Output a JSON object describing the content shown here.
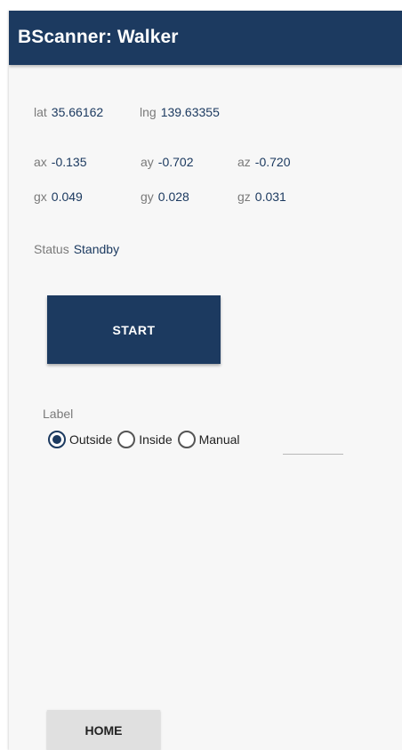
{
  "appbar": {
    "title": "BScanner: Walker"
  },
  "location": {
    "lat_label": "lat",
    "lat_value": "35.66162",
    "lng_label": "lng",
    "lng_value": "139.63355"
  },
  "accelerometer": {
    "ax_label": "ax",
    "ax_value": "-0.135",
    "ay_label": "ay",
    "ay_value": "-0.702",
    "az_label": "az",
    "az_value": "-0.720"
  },
  "gyroscope": {
    "gx_label": "gx",
    "gx_value": "0.049",
    "gy_label": "gy",
    "gy_value": "0.028",
    "gz_label": "gz",
    "gz_value": "0.031"
  },
  "status": {
    "label": "Status",
    "value": "Standby"
  },
  "start_button": {
    "label": "START"
  },
  "label_group": {
    "caption": "Label",
    "options": [
      {
        "label": "Outside",
        "checked": true
      },
      {
        "label": "Inside",
        "checked": false
      },
      {
        "label": "Manual",
        "checked": false
      }
    ],
    "manual_value": ""
  },
  "home_button": {
    "label": "HOME"
  },
  "colors": {
    "primary": "#1c3a60",
    "background": "#f7f7f7",
    "secondary_button": "#e0e0e0"
  }
}
